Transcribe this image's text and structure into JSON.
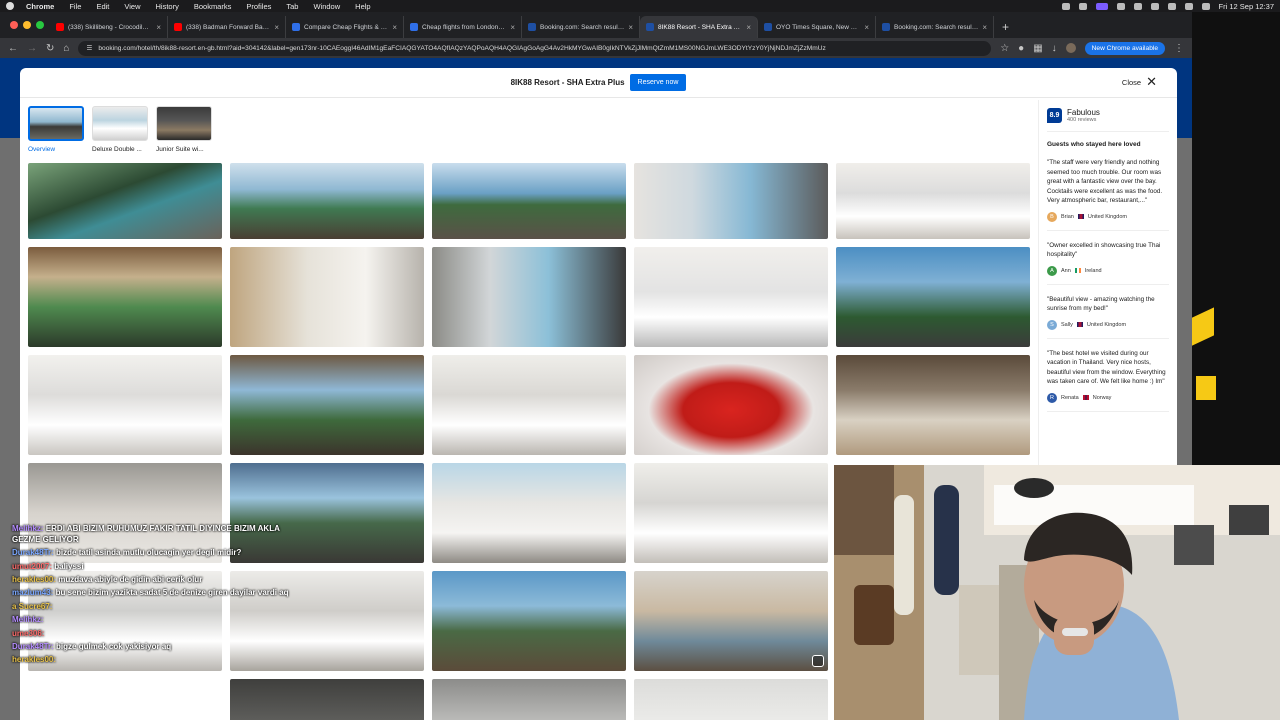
{
  "menubar": {
    "app": "Chrome",
    "items": [
      "File",
      "Edit",
      "View",
      "History",
      "Bookmarks",
      "Profiles",
      "Tab",
      "Window",
      "Help"
    ],
    "clock": "Fri 12 Sep  12:37"
  },
  "tabs": [
    {
      "title": "(338) Skillibeng - Crocodile T...",
      "fav_color": "#ff0000"
    },
    {
      "title": "(338) Badman Forward Badm...",
      "fav_color": "#ff0000"
    },
    {
      "title": "Compare Cheap Flights & Bo...",
      "fav_color": "#2f6fe8"
    },
    {
      "title": "Cheap flights from London to...",
      "fav_color": "#2f6fe8"
    },
    {
      "title": "Booking.com: Search results...",
      "fav_color": "#1e4fa3"
    },
    {
      "title": "8IK88 Resort - SHA Extra Pl...",
      "fav_color": "#1e4fa3"
    },
    {
      "title": "OYO Times Square, New York...",
      "fav_color": "#1e4fa3"
    },
    {
      "title": "Booking.com: Search results...",
      "fav_color": "#1e4fa3"
    }
  ],
  "toolbar": {
    "url": "booking.com/hotel/th/8ik88-resort.en-gb.html?aid=304142&label=gen173nr-10CAEoggI46AdIM1gEaFCIAQGYATO4AQfIAQzYAQPoAQH4AQGIAgGoAgG4Av2HkMYGwAIB0gIkNTVkZjJlMmQtZmM1MS00NGJmLWE3ODYtYzY0YjNjNDJmZjZzMmUz",
    "new_chrome": "New Chrome available"
  },
  "modal": {
    "title": "8IK88 Resort - SHA Extra Plus",
    "reserve_label": "Reserve now",
    "close_label": "Close"
  },
  "thumbs": [
    {
      "label": "Overview"
    },
    {
      "label": "Deluxe Double ..."
    },
    {
      "label": "Junior Suite wi..."
    }
  ],
  "reviews": {
    "score": "8.9",
    "score_label": "Fabulous",
    "review_count": "400 reviews",
    "heading": "Guests who stayed here loved",
    "items": [
      {
        "text": "\"The staff were very friendly and nothing seemed too much trouble. Our room was great with a fantastic view over the bay. Cocktails were excellent as was the food. Very atmospheric bar, restaurant,...\"",
        "initial": "B",
        "name": "Brian",
        "country": "United Kingdom",
        "color": "#e6a85c"
      },
      {
        "text": "\"Owner excelled in showcasing true Thai hospitality\"",
        "initial": "A",
        "name": "Ann",
        "country": "Ireland",
        "color": "#3c9a4a"
      },
      {
        "text": "\"Beautiful view - amazing watching the sunrise from my bed!\"",
        "initial": "S",
        "name": "Sally",
        "country": "United Kingdom",
        "color": "#7aaad6"
      },
      {
        "text": "\"The best hotel we visited during our vacation in Thailand. Very nice hosts, beautiful view from the window. Everything was taken care of. We felt like home :) Im\"",
        "initial": "R",
        "name": "Renata",
        "country": "Norway",
        "color": "#2e5aa8"
      }
    ]
  },
  "chat": [
    {
      "user": "Melihkz:",
      "msg": "ERDI ABI BIZIM RUHUMUZ FAKIR TATIL DIYINCE BIZIM AKLA GEZME GELIYOR",
      "uclass": "u1"
    },
    {
      "user": "Durak48Tr:",
      "msg": "bizde tatil asinda mutlu olucagin yer degil midir?",
      "uclass": "u4"
    },
    {
      "user": "umut2007:",
      "msg": "baliyssi",
      "uclass": "u3"
    },
    {
      "user": "herakles00:",
      "msg": "muzdava abiyle de gidin abi cerik olur",
      "uclass": "u2"
    },
    {
      "user": "mazlum43:",
      "msg": "bu sene bizim yazikta sadat 5 de denize giren dayilar vardi aq",
      "uclass": "u4"
    },
    {
      "user": "a Sucre67:",
      "msg": "",
      "uclass": "u2"
    },
    {
      "user": "Melihkz:",
      "msg": "",
      "uclass": "u1"
    },
    {
      "user": "ume306:",
      "msg": "",
      "uclass": "u3"
    },
    {
      "user": "Durak48Tr:",
      "msg": "bigze gulmek cok yakisiyor aq",
      "uclass": "u1"
    },
    {
      "user": "herakles00:",
      "msg": "",
      "uclass": "u2"
    }
  ]
}
